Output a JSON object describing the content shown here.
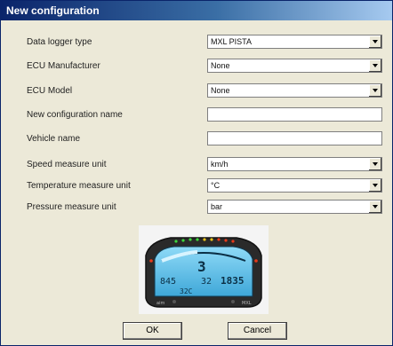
{
  "window": {
    "title": "New configuration"
  },
  "fields": [
    {
      "label": "Data logger type",
      "type": "combo",
      "value": "MXL PISTA"
    },
    {
      "label": "ECU Manufacturer",
      "type": "combo",
      "value": "None"
    },
    {
      "label": "ECU Model",
      "type": "combo",
      "value": "None"
    },
    {
      "label": "New configuration name",
      "type": "text",
      "value": ""
    },
    {
      "label": "Vehicle name",
      "type": "text",
      "value": ""
    },
    {
      "label": "Speed measure unit",
      "type": "combo",
      "value": "km/h"
    },
    {
      "label": "Temperature measure unit",
      "type": "combo",
      "value": "°C"
    },
    {
      "label": "Pressure measure unit",
      "type": "combo",
      "value": "bar"
    }
  ],
  "dashboard": {
    "gear": "3",
    "readout_left": "845",
    "readout_mid": "32",
    "readout_right": "1835",
    "readout_bottom": "32C",
    "brand_left": "aim",
    "brand_right": "MXL"
  },
  "buttons": {
    "ok": "OK",
    "cancel": "Cancel"
  },
  "colors": {
    "title_start": "#0a246a",
    "title_end": "#a6caf0",
    "dialog_bg": "#ece9d8",
    "lcd": "#5fc6f0"
  }
}
